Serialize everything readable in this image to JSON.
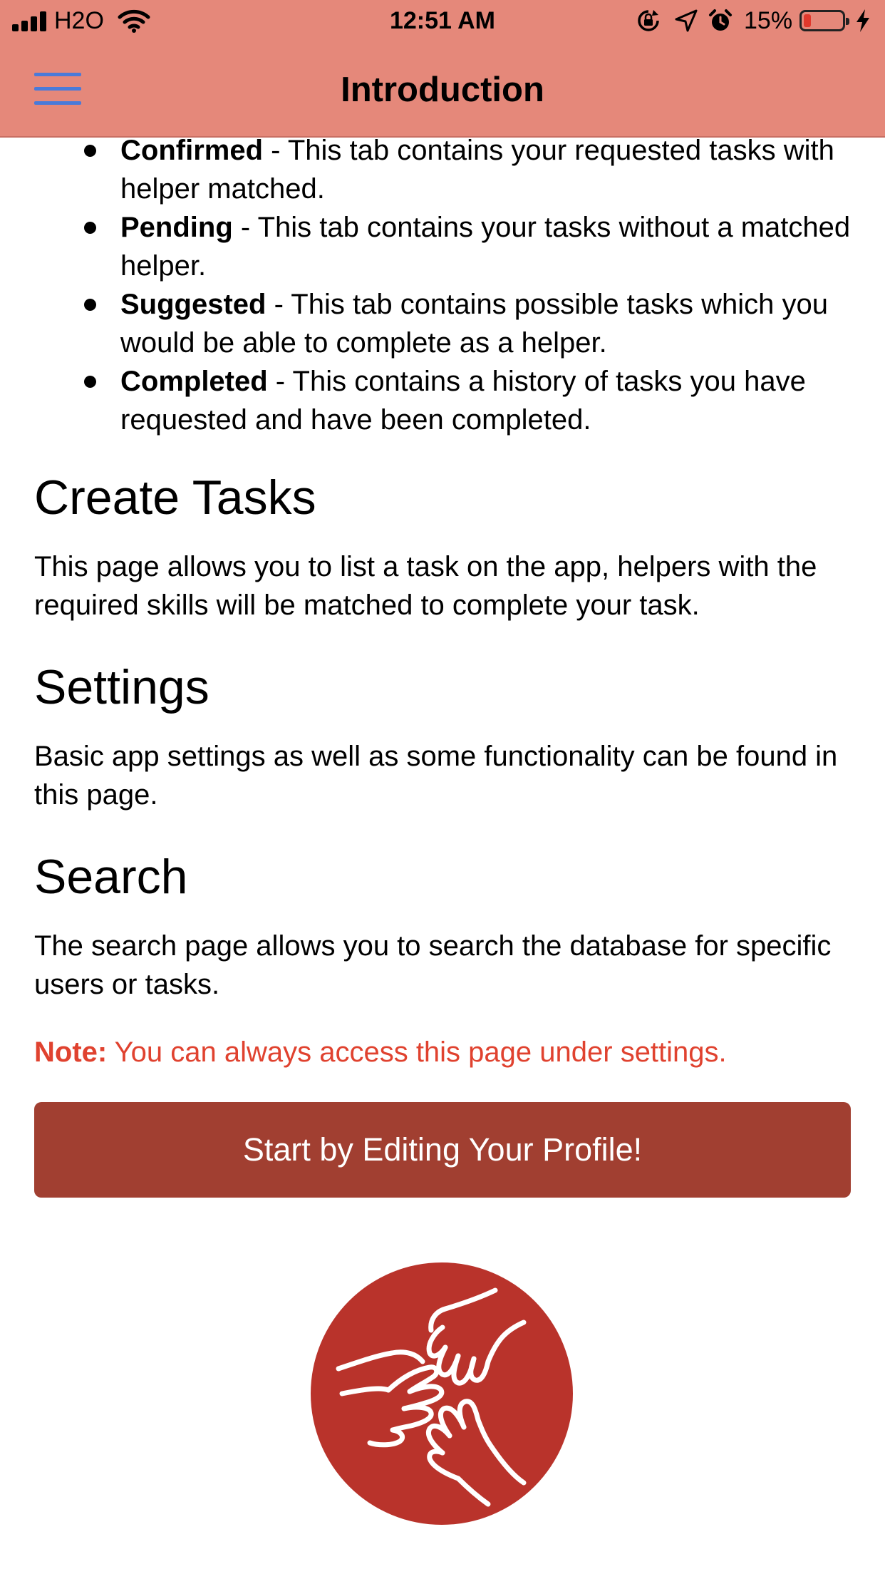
{
  "status_bar": {
    "carrier": "H2O",
    "time": "12:51 AM",
    "battery_percent": "15%",
    "battery_level": 0.15,
    "icons": [
      "signal-icon",
      "wifi-icon",
      "rotation-lock-icon",
      "location-icon",
      "alarm-icon",
      "battery-icon",
      "charging-icon"
    ]
  },
  "nav": {
    "title": "Introduction",
    "menu_icon": "hamburger-menu-icon",
    "bar_color": "#e5887a",
    "menu_icon_color": "#4a7ad9"
  },
  "tabs_list": [
    {
      "name": "Confirmed",
      "desc": " - This tab contains your requested tasks with helper matched."
    },
    {
      "name": "Pending",
      "desc": " - This tab contains your tasks without a matched helper."
    },
    {
      "name": "Suggested",
      "desc": " - This tab contains possible tasks which you would be able to complete as a helper."
    },
    {
      "name": "Completed",
      "desc": " - This contains a history of tasks you have requested and have been completed."
    }
  ],
  "sections": {
    "create": {
      "title": "Create Tasks",
      "body": "This page allows you to list a task on the app, helpers with the required skills will be matched to complete your task."
    },
    "settings": {
      "title": "Settings",
      "body": "Basic app settings as well as some functionality can be found in this page."
    },
    "search": {
      "title": "Search",
      "body": "The search page allows you to search the database for specific users or tasks."
    }
  },
  "note": {
    "label": "Note:",
    "text": " You can always access this page under settings.",
    "color": "#e0422f"
  },
  "cta": {
    "label": "Start by Editing Your Profile!",
    "color": "#a13f31"
  },
  "logo": {
    "icon": "helping-hands-logo",
    "color": "#b9332b"
  }
}
